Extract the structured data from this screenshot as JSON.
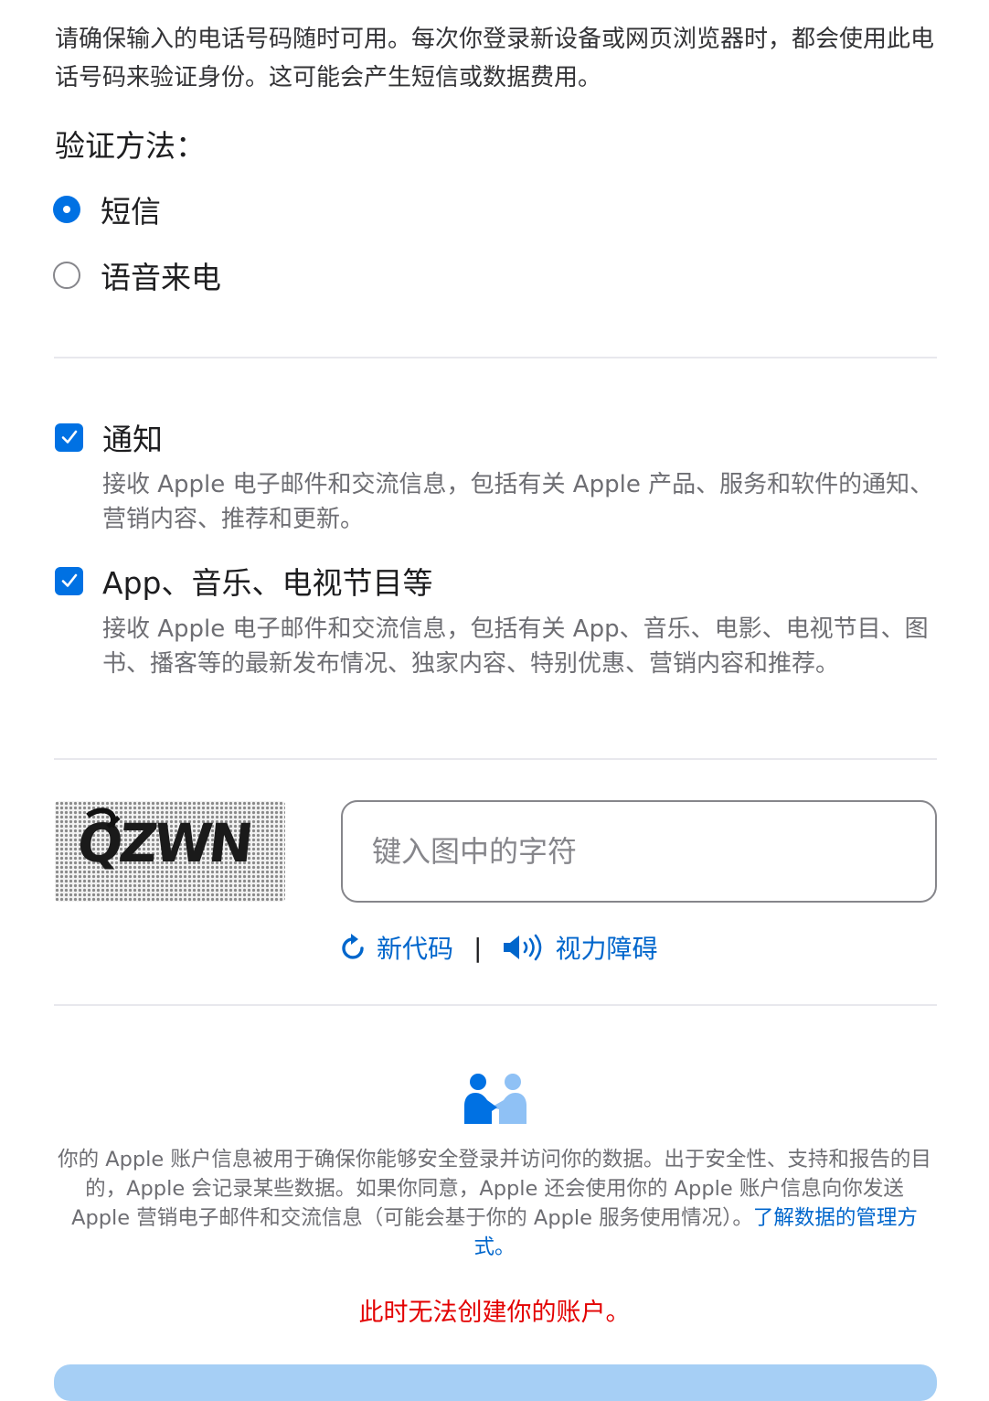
{
  "intro_text": "请确保输入的电话号码随时可用。每次你登录新设备或网页浏览器时，都会使用此电话号码来验证身份。这可能会产生短信或数据费用。",
  "verification": {
    "label": "验证方法：",
    "options": [
      {
        "label": "短信",
        "selected": true
      },
      {
        "label": "语音来电",
        "selected": false
      }
    ]
  },
  "subscriptions": [
    {
      "title": "通知",
      "checked": true,
      "description": "接收 Apple 电子邮件和交流信息，包括有关 Apple 产品、服务和软件的通知、营销内容、推荐和更新。"
    },
    {
      "title": "App、音乐、电视节目等",
      "checked": true,
      "description": "接收 Apple 电子邮件和交流信息，包括有关 App、音乐、电影、电视节目、图书、播客等的最新发布情况、独家内容、特别优惠、营销内容和推荐。"
    }
  ],
  "captcha": {
    "image_text": "QZWN",
    "input_placeholder": "键入图中的字符",
    "input_value": "",
    "new_code_label": "新代码",
    "separator": "|",
    "audio_label": "视力障碍",
    "new_code_icon": "refresh-icon",
    "audio_icon": "speaker-icon"
  },
  "privacy": {
    "icon": "people-handshake-icon",
    "text": "你的 Apple 账户信息被用于确保你能够安全登录并访问你的数据。出于安全性、支持和报告的目的，Apple 会记录某些数据。如果你同意，Apple 还会使用你的 Apple 账户信息向你发送 Apple 营销电子邮件和交流信息（可能会基于你的 Apple 服务使用情况）。",
    "link_text": "了解数据的管理方式。"
  },
  "error_message": "此时无法创建你的账户。",
  "colors": {
    "accent": "#0071e3",
    "link": "#0066cc",
    "error": "#e30000",
    "button_disabled": "#a6cff5"
  }
}
